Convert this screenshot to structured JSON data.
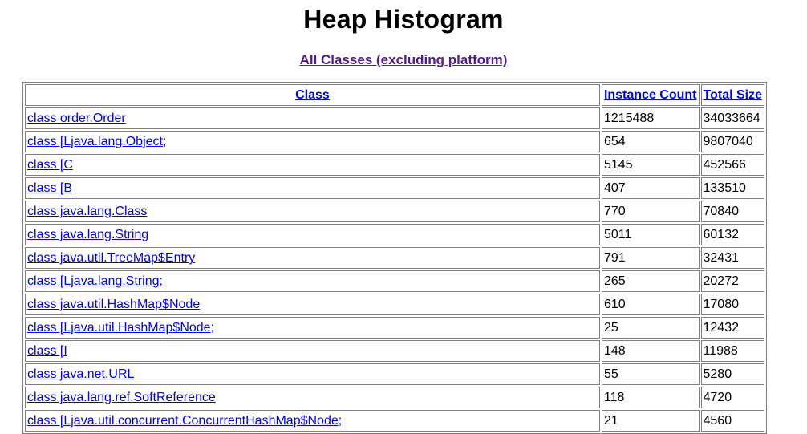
{
  "page": {
    "title": "Heap Histogram",
    "subtitle_link": "All Classes (excluding platform)"
  },
  "table": {
    "headers": [
      "Class",
      "Instance Count",
      "Total Size"
    ],
    "rows": [
      {
        "class": "class order.Order",
        "count": "1215488",
        "size": "34033664"
      },
      {
        "class": "class [Ljava.lang.Object;",
        "count": "654",
        "size": "9807040"
      },
      {
        "class": "class [C",
        "count": "5145",
        "size": "452566"
      },
      {
        "class": "class [B",
        "count": "407",
        "size": "133510"
      },
      {
        "class": "class java.lang.Class",
        "count": "770",
        "size": "70840"
      },
      {
        "class": "class java.lang.String",
        "count": "5011",
        "size": "60132"
      },
      {
        "class": "class java.util.TreeMap$Entry",
        "count": "791",
        "size": "32431"
      },
      {
        "class": "class [Ljava.lang.String;",
        "count": "265",
        "size": "20272"
      },
      {
        "class": "class java.util.HashMap$Node",
        "count": "610",
        "size": "17080"
      },
      {
        "class": "class [Ljava.util.HashMap$Node;",
        "count": "25",
        "size": "12432"
      },
      {
        "class": "class [I",
        "count": "148",
        "size": "11988"
      },
      {
        "class": "class java.net.URL",
        "count": "55",
        "size": "5280"
      },
      {
        "class": "class java.lang.ref.SoftReference",
        "count": "118",
        "size": "4720"
      },
      {
        "class": "class [Ljava.util.concurrent.ConcurrentHashMap$Node;",
        "count": "21",
        "size": "4560"
      }
    ]
  }
}
